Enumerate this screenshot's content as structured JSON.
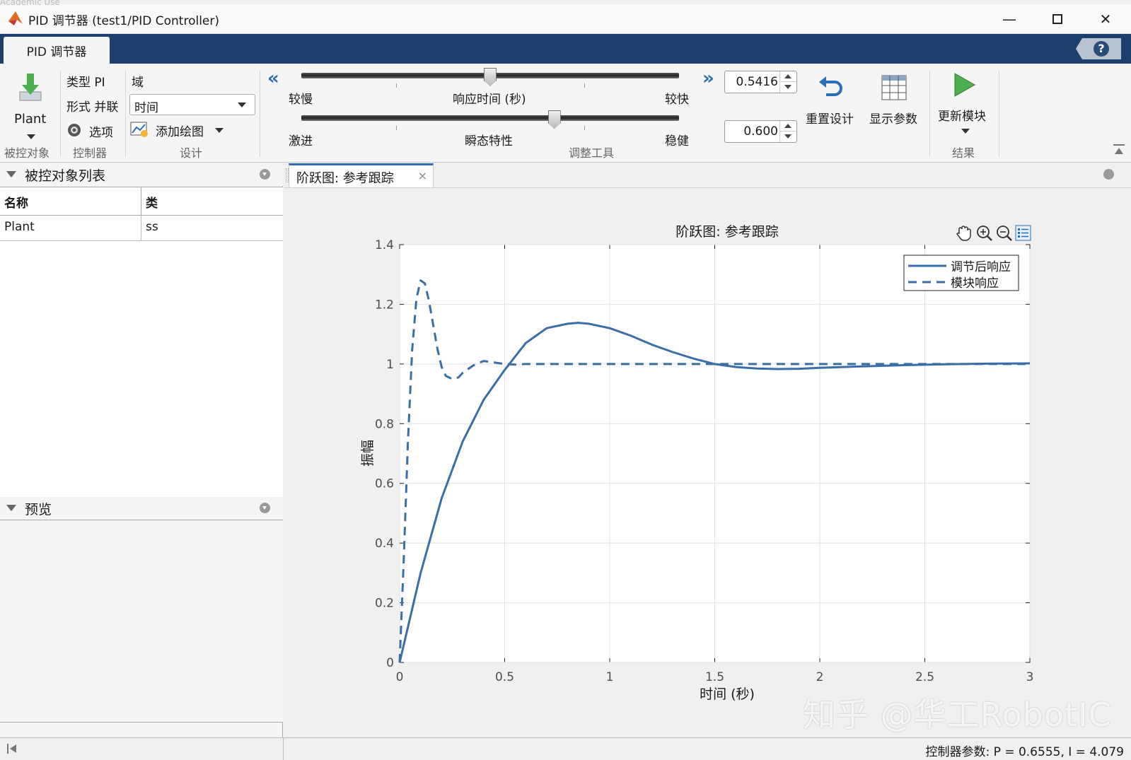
{
  "window": {
    "academic": "Academic Use",
    "title": "PID 调节器 (test1/PID Controller)",
    "min_icon": "minimize-icon",
    "max_icon": "maximize-icon",
    "close_icon": "close-icon"
  },
  "tabs": {
    "active": "PID 调节器",
    "help": "?"
  },
  "toolstrip": {
    "plant": {
      "label": "Plant",
      "group": "被控对象"
    },
    "controller": {
      "type": "类型 PI",
      "form": "形式 并联",
      "options": "选项",
      "group": "控制器"
    },
    "design": {
      "domain_label": "域",
      "domain_value": "时间",
      "add_plot": "添加绘图",
      "group": "设计"
    },
    "tuning": {
      "response_time": {
        "left": "较慢",
        "center": "响应时间 (秒)",
        "right": "较快",
        "value": "0.5416",
        "fraction": 0.5
      },
      "transient": {
        "left": "激进",
        "center": "瞬态特性",
        "right": "稳健",
        "value": "0.600",
        "fraction": 0.67
      },
      "group": "调整工具"
    },
    "reset": "重置设计",
    "show_params": "显示参数",
    "update_block": "更新模块",
    "results_group": "结果"
  },
  "left": {
    "plant_list_title": "被控对象列表",
    "columns": [
      "名称",
      "类"
    ],
    "rows": [
      [
        "Plant",
        "ss"
      ]
    ],
    "preview_title": "预览"
  },
  "doc_tab": {
    "label": "阶跃图: 参考跟踪",
    "close": "×"
  },
  "status": "控制器参数: P = 0.6555, I = 4.079",
  "watermark": "知乎 @华工RobotIC",
  "chart_data": {
    "type": "line",
    "title": "阶跃图: 参考跟踪",
    "xlabel": "时间 (秒)",
    "ylabel": "振幅",
    "xlim": [
      0,
      3
    ],
    "ylim": [
      0,
      1.4
    ],
    "xticks": [
      0,
      0.5,
      1,
      1.5,
      2,
      2.5,
      3
    ],
    "yticks": [
      0,
      0.2,
      0.4,
      0.6,
      0.8,
      1,
      1.2,
      1.4
    ],
    "xtick_labels": [
      "0",
      "0.5",
      "1",
      "1.5",
      "2",
      "2.5",
      "3"
    ],
    "ytick_labels": [
      "0",
      "0.2",
      "0.4",
      "0.6",
      "0.8",
      "1",
      "1.2",
      "1.4"
    ],
    "grid": true,
    "legend_position": "top-right",
    "series": [
      {
        "name": "调节后响应",
        "style": "solid",
        "color": "#3a6ea5",
        "x": [
          0,
          0.1,
          0.2,
          0.3,
          0.4,
          0.5,
          0.6,
          0.7,
          0.8,
          0.85,
          0.9,
          1.0,
          1.1,
          1.2,
          1.3,
          1.4,
          1.5,
          1.6,
          1.7,
          1.8,
          1.9,
          2.0,
          2.2,
          2.4,
          2.6,
          2.8,
          3.0
        ],
        "y": [
          0,
          0.3,
          0.55,
          0.74,
          0.88,
          0.98,
          1.07,
          1.12,
          1.135,
          1.138,
          1.135,
          1.12,
          1.095,
          1.065,
          1.04,
          1.018,
          1.0,
          0.99,
          0.985,
          0.983,
          0.984,
          0.987,
          0.992,
          0.996,
          0.999,
          1.001,
          1.002
        ]
      },
      {
        "name": "模块响应",
        "style": "dashed",
        "color": "#3a6ea5",
        "x": [
          0,
          0.02,
          0.04,
          0.06,
          0.08,
          0.1,
          0.12,
          0.14,
          0.16,
          0.18,
          0.2,
          0.22,
          0.25,
          0.28,
          0.3,
          0.35,
          0.4,
          0.45,
          0.5,
          0.55,
          0.6,
          1.0,
          2.0,
          3.0
        ],
        "y": [
          0,
          0.35,
          0.75,
          1.05,
          1.22,
          1.28,
          1.27,
          1.21,
          1.13,
          1.05,
          0.99,
          0.96,
          0.95,
          0.955,
          0.97,
          0.995,
          1.01,
          1.005,
          1.0,
          0.998,
          1.0,
          1.0,
          1.0,
          1.0
        ]
      }
    ]
  }
}
